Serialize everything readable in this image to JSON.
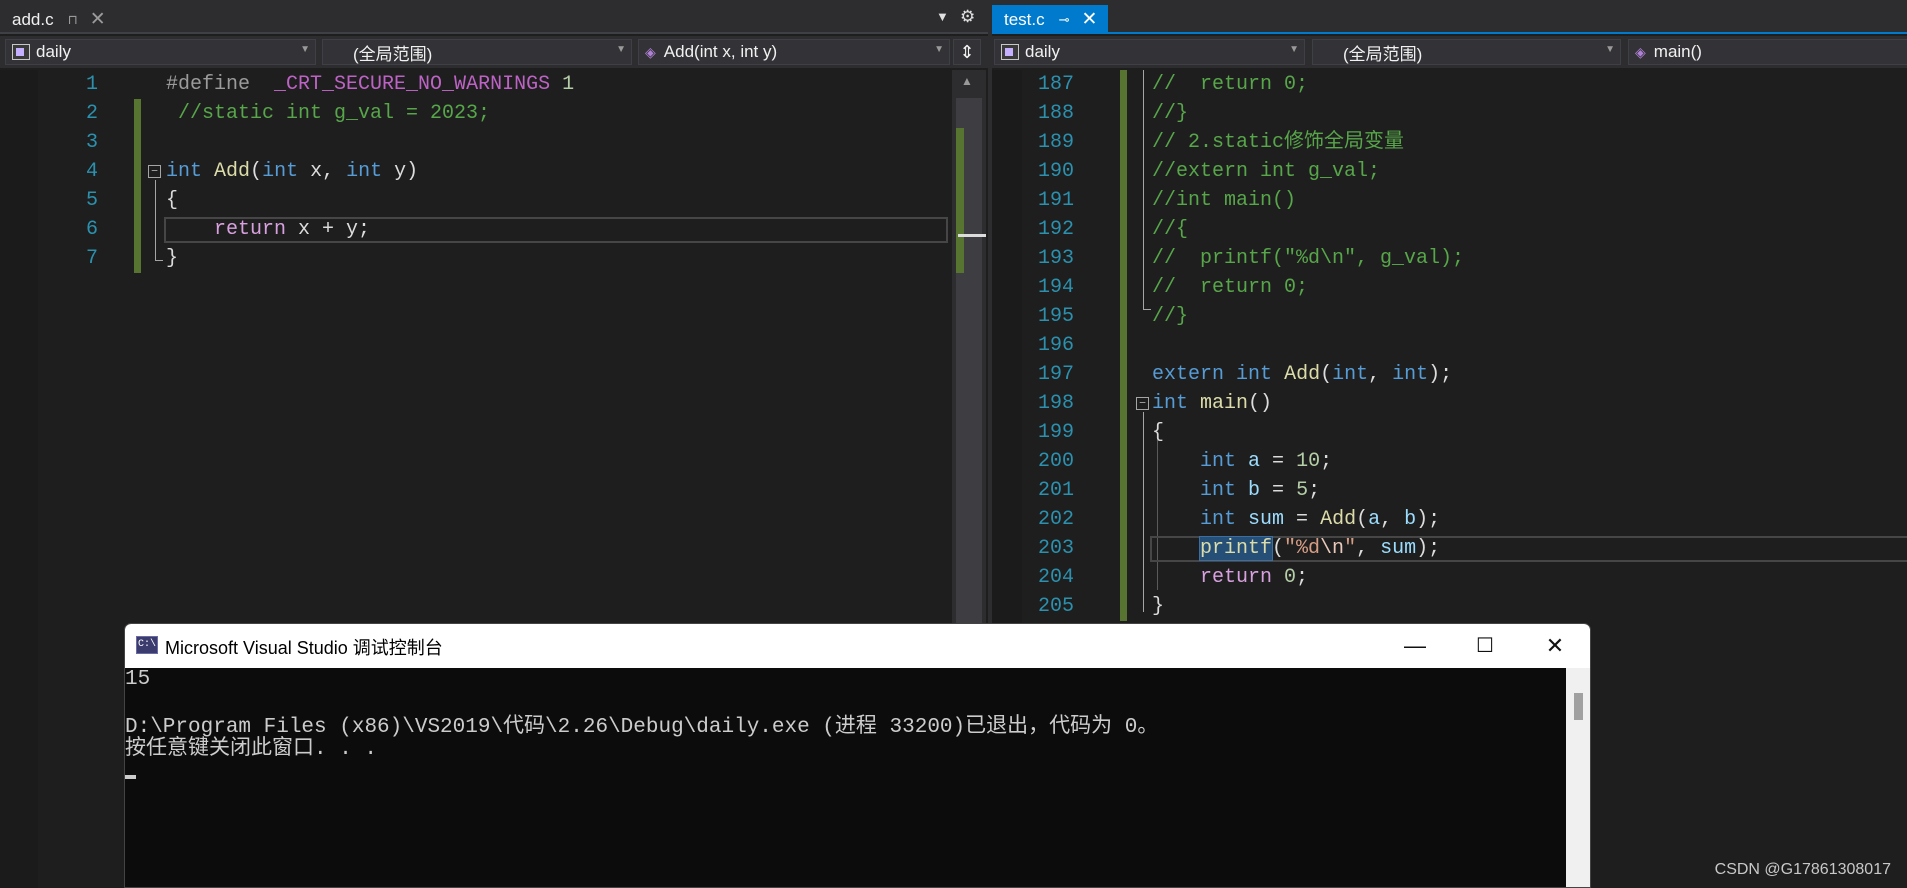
{
  "left": {
    "tab_title": "add.c",
    "pin_icon": "pin-icon",
    "close_icon": "close-icon",
    "project_dropdown": "daily",
    "scope_dropdown": "(全局范围)",
    "member_dropdown": "Add(int x, int y)",
    "line_numbers": [
      "1",
      "2",
      "3",
      "4",
      "5",
      "6",
      "7"
    ],
    "code": {
      "l1_kw": "#define",
      "l1_macro": "_CRT_SECURE_NO_WARNINGS",
      "l1_num": "1",
      "l2": "//static int g_val = 2023;",
      "l4_kw1": "int",
      "l4_fn": "Add",
      "l4_p1": "(",
      "l4_kw2": "int",
      "l4_x": "x,",
      "l4_kw3": "int",
      "l4_y": "y)",
      "l5": "{",
      "l6_ret": "return",
      "l6_rest": "x + y;",
      "l7": "}"
    }
  },
  "right": {
    "tab_title": "test.c",
    "project_dropdown": "daily",
    "scope_dropdown": "(全局范围)",
    "member_dropdown": "main()",
    "line_numbers": [
      "187",
      "188",
      "189",
      "190",
      "191",
      "192",
      "193",
      "194",
      "195",
      "196",
      "197",
      "198",
      "199",
      "200",
      "201",
      "202",
      "203",
      "204",
      "205"
    ],
    "code": {
      "l187": "//  return 0;",
      "l188": "//}",
      "l189": "// 2.static修饰全局变量",
      "l190": "//extern int g_val;",
      "l191": "//int main()",
      "l192": "//{",
      "l193": "//  printf(\"%d\\n\", g_val);",
      "l194": "//  return 0;",
      "l195": "//}",
      "l197_kw1": "extern",
      "l197_kw2": "int",
      "l197_fn": "Add",
      "l197_p": "(",
      "l197_kw3": "int",
      "l197_c": ",",
      "l197_kw4": "int",
      "l197_end": ");",
      "l198_kw": "int",
      "l198_fn": "main",
      "l198_p": "()",
      "l199": "{",
      "l200_kw": "int",
      "l200_id": "a",
      "l200_eq": " = ",
      "l200_num": "10",
      "l200_end": ";",
      "l201_kw": "int",
      "l201_id": "b",
      "l201_eq": " = ",
      "l201_num": "5",
      "l201_end": ";",
      "l202_kw": "int",
      "l202_id": "sum",
      "l202_eq": " = ",
      "l202_fn": "Add",
      "l202_p1": "(",
      "l202_a": "a",
      "l202_c": ", ",
      "l202_b": "b",
      "l202_end": ");",
      "l203_fn": "printf",
      "l203_p": "(",
      "l203_s1": "\"%d",
      "l203_esc": "\\n",
      "l203_s2": "\"",
      "l203_c": ", ",
      "l203_id": "sum",
      "l203_end": ");",
      "l204_ret": "return",
      "l204_num": "0",
      "l204_end": ";",
      "l205": "}"
    }
  },
  "toolbar": {
    "dropdown_icon": "dropdown-arrow-icon",
    "settings_icon": "gear-icon",
    "split_icon": "split-view-icon"
  },
  "console": {
    "title": "Microsoft Visual Studio 调试控制台",
    "icon_text": "C:\\",
    "minimize_icon": "—",
    "maximize_icon": "☐",
    "close_icon": "✕",
    "lines": [
      "15",
      "",
      "D:\\Program Files (x86)\\VS2019\\代码\\2.26\\Debug\\daily.exe (进程 33200)已退出，代码为 0。",
      "按任意键关闭此窗口. . ."
    ]
  },
  "watermark": "CSDN @G17861308017",
  "colors": {
    "accent": "#007acc",
    "editor_bg": "#1e1e1e",
    "keyword": "#569cd6",
    "comment": "#57a64a",
    "function": "#dcdcaa",
    "change_bar": "#577430"
  }
}
